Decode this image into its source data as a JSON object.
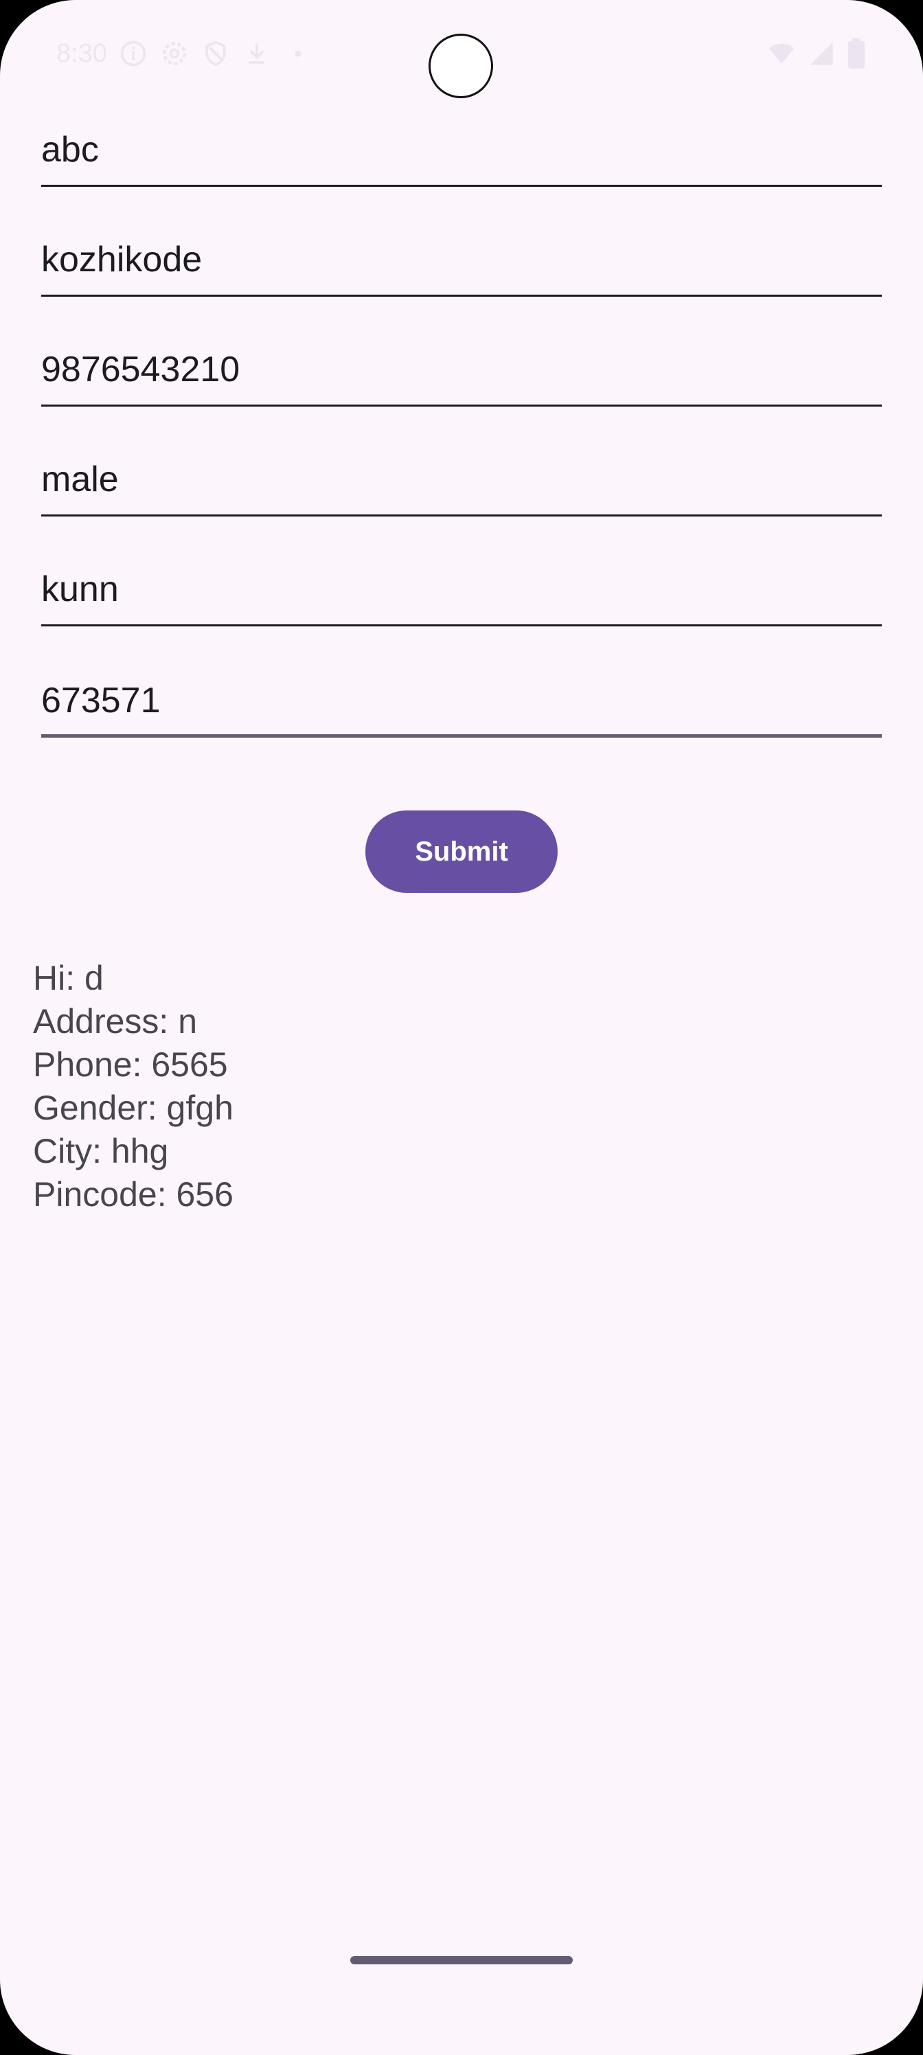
{
  "status_bar": {
    "time": "8:30",
    "left_icons": [
      "info-icon",
      "settings-icon",
      "shield-icon",
      "download-icon",
      "dot-icon"
    ],
    "right_icons": [
      "wifi-icon",
      "signal-icon",
      "battery-icon"
    ]
  },
  "form": {
    "name_value": "abc",
    "address_value": "kozhikode",
    "phone_value": "9876543210",
    "gender_value": "male",
    "city_value": "kunn",
    "pincode_value": "673571",
    "submit_label": "Submit"
  },
  "output": {
    "greeting": "Hi: d",
    "address": "Address: n",
    "phone": "Phone: 6565",
    "gender": "Gender: gfgh",
    "city": "City: hhg",
    "pincode": "Pincode: 656"
  },
  "colors": {
    "background": "#FCF5FC",
    "primary": "#6750A4",
    "text": "#1D1B20",
    "secondary_text": "#49454F"
  }
}
